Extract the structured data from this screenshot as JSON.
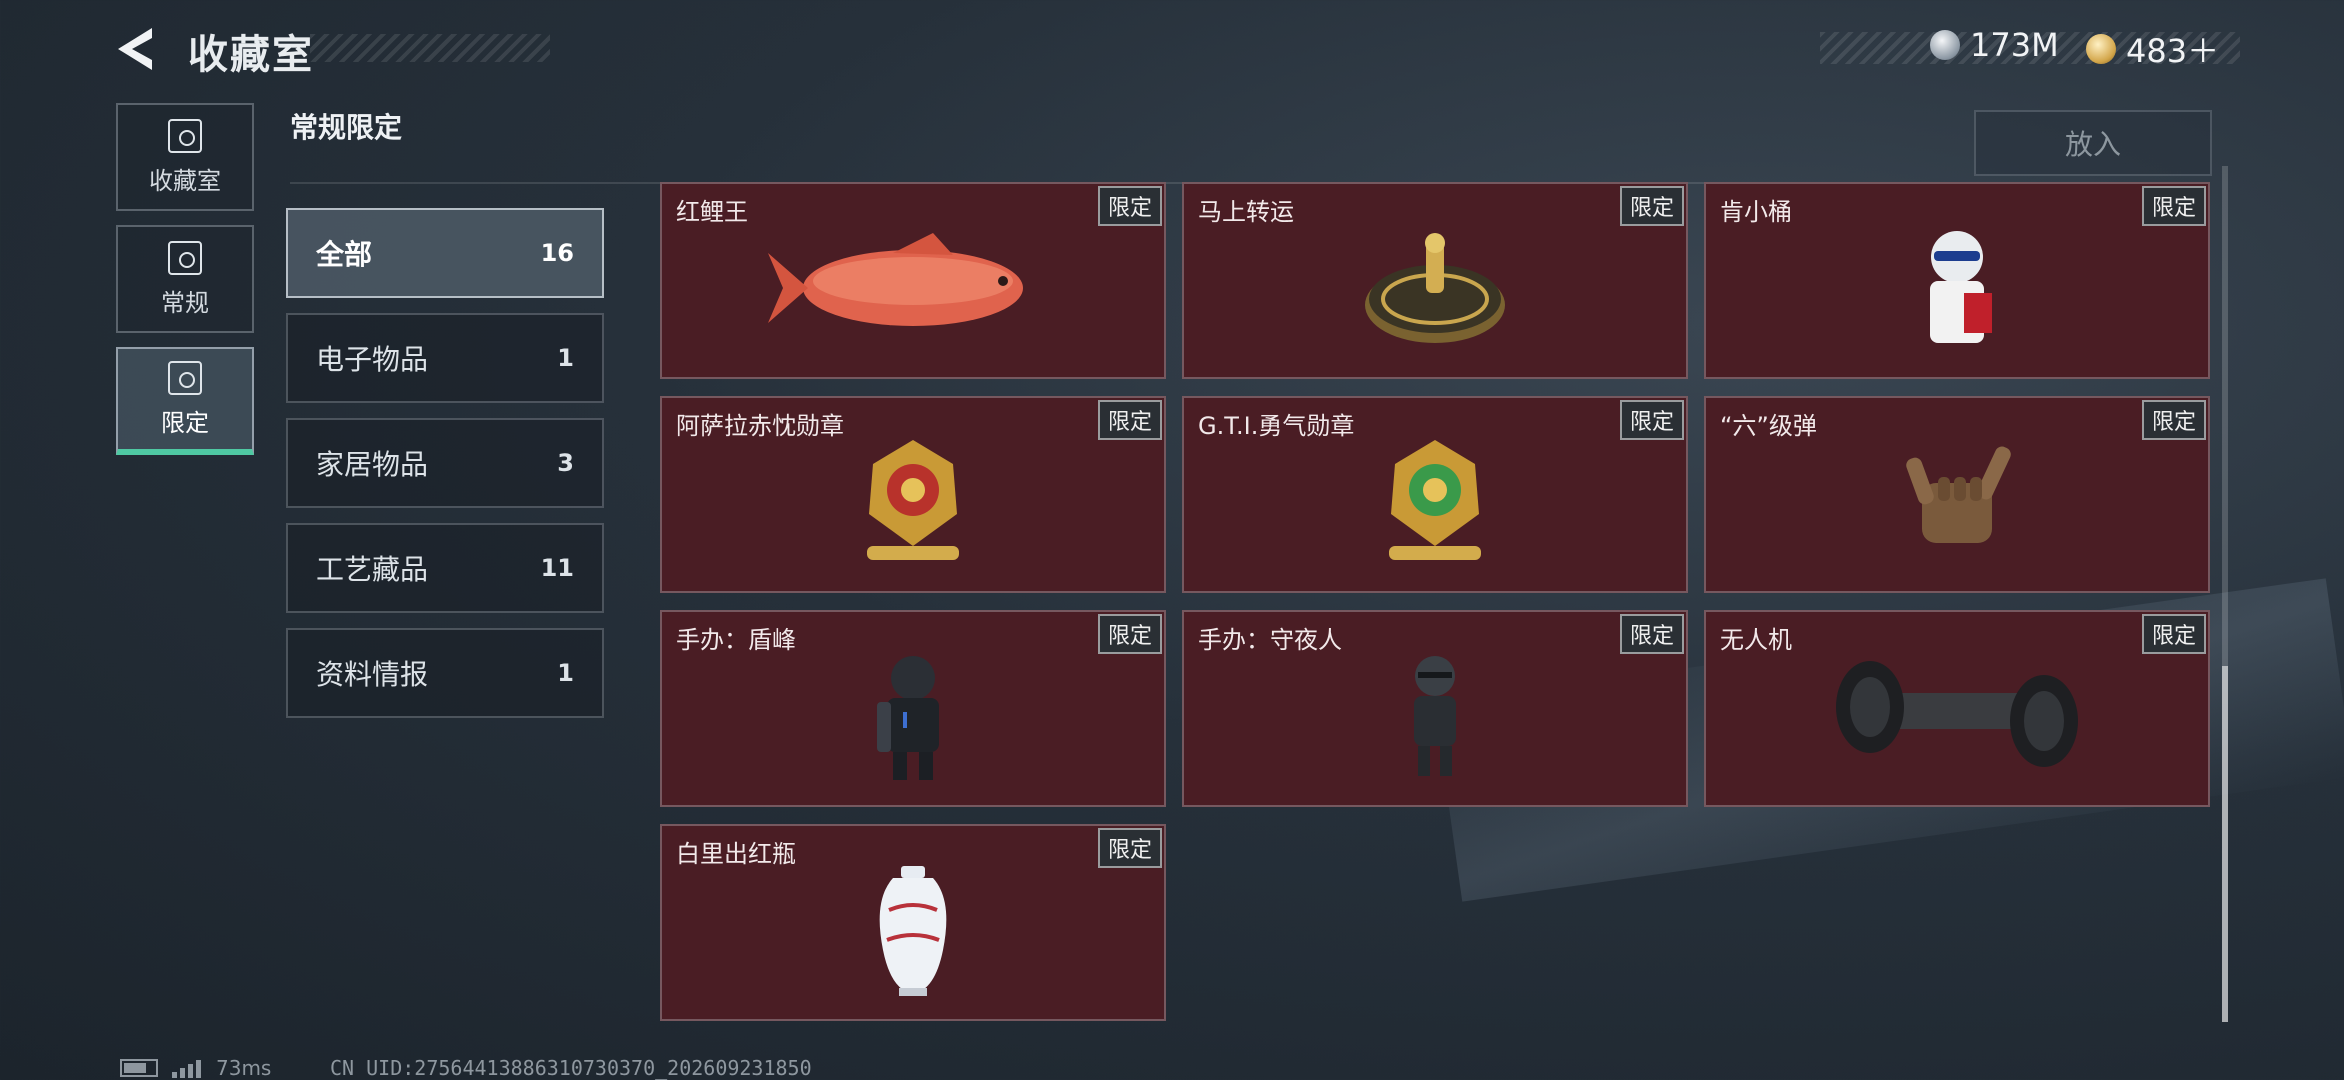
{
  "header": {
    "title": "收藏室",
    "currencies": [
      {
        "icon": "silver-coin-icon",
        "value": "173M"
      },
      {
        "icon": "gold-coin-icon",
        "value": "483＋"
      }
    ]
  },
  "left_nav": [
    {
      "label": "收藏室",
      "icon": "trophy-case-icon",
      "active": false
    },
    {
      "label": "常规",
      "icon": "document-icon",
      "active": false
    },
    {
      "label": "限定",
      "icon": "limited-gallery-icon",
      "active": true
    }
  ],
  "section": {
    "title": "常规限定",
    "put_button": "放入"
  },
  "categories": [
    {
      "label": "全部",
      "count": "16",
      "active": true
    },
    {
      "label": "电子物品",
      "count": "1",
      "active": false
    },
    {
      "label": "家居物品",
      "count": "3",
      "active": false
    },
    {
      "label": "工艺藏品",
      "count": "11",
      "active": false
    },
    {
      "label": "资料情报",
      "count": "1",
      "active": false
    }
  ],
  "items": [
    {
      "name": "红鲤王",
      "badge": "限定",
      "art": "red-carp"
    },
    {
      "name": "马上转运",
      "badge": "限定",
      "art": "gold-compass"
    },
    {
      "name": "肯小桶",
      "badge": "限定",
      "art": "kfc-figure"
    },
    {
      "name": "阿萨拉赤忱勋章",
      "badge": "限定",
      "art": "red-medal"
    },
    {
      "name": "G.T.I.勇气勋章",
      "badge": "限定",
      "art": "green-medal"
    },
    {
      "name": "“六”级弹",
      "badge": "限定",
      "art": "bronze-hand"
    },
    {
      "name": "手办：盾峰",
      "badge": "限定",
      "art": "armored-figure"
    },
    {
      "name": "手办：守夜人",
      "badge": "限定",
      "art": "ninja-figure"
    },
    {
      "name": "无人机",
      "badge": "限定",
      "art": "drone-roller"
    },
    {
      "name": "白里出红瓶",
      "badge": "限定",
      "art": "porcelain-vase"
    }
  ],
  "status_bar": {
    "ping": "73ms",
    "uid": "CN UID:27564413886310730370_202609231850"
  }
}
